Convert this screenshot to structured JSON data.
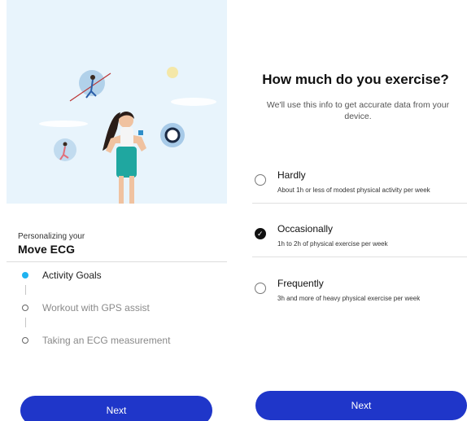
{
  "onboarding": {
    "subtitle": "Personalizing your",
    "product": "Move ECG",
    "steps": [
      {
        "label": "Activity Goals",
        "state": "active"
      },
      {
        "label": "Workout with GPS assist",
        "state": "pending"
      },
      {
        "label": "Taking an ECG measurement",
        "state": "pending"
      }
    ],
    "next_label": "Next"
  },
  "exercise": {
    "title": "How much do you exercise?",
    "subtitle": "We'll use this info to get accurate data from your device.",
    "options": [
      {
        "label": "Hardly",
        "description": "About 1h or less of modest physical activity per week",
        "selected": false
      },
      {
        "label": "Occasionally",
        "description": "1h to 2h of physical exercise per week",
        "selected": true
      },
      {
        "label": "Frequently",
        "description": "3h and more of heavy physical exercise per week",
        "selected": false
      }
    ],
    "next_label": "Next"
  },
  "colors": {
    "accent": "#1f36c9",
    "step_active": "#1fb3f0",
    "hero_background": "#e8f4fc"
  },
  "icons": [
    "illustration-woman",
    "running-person-icon",
    "watch-icon",
    "sun-icon"
  ]
}
